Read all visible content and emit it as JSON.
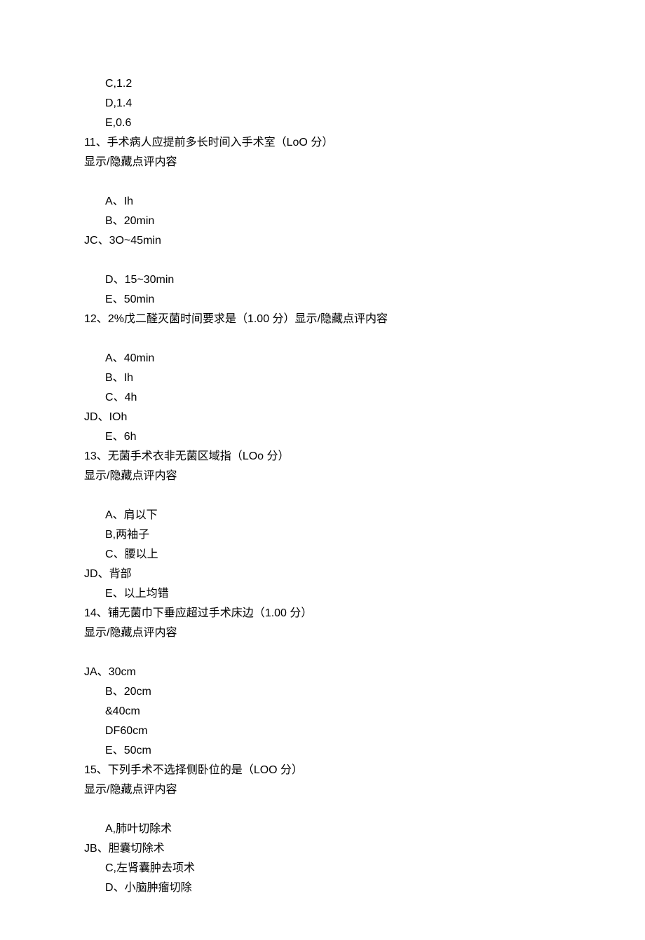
{
  "lines": [
    {
      "cls": "indent",
      "text": "C,1.2"
    },
    {
      "cls": "indent",
      "text": "D,1.4"
    },
    {
      "cls": "indent",
      "text": "E,0.6"
    },
    {
      "cls": "",
      "text": "11、手术病人应提前多长时间入手术室（LoO 分）"
    },
    {
      "cls": "",
      "text": "显示/隐藏点评内容"
    },
    {
      "cls": "",
      "text": ""
    },
    {
      "cls": "indent",
      "text": "A、Ih"
    },
    {
      "cls": "indent",
      "text": "B、20min"
    },
    {
      "cls": "",
      "text": "JC、3O~45min"
    },
    {
      "cls": "",
      "text": ""
    },
    {
      "cls": "indent",
      "text": "D、15~30min"
    },
    {
      "cls": "indent",
      "text": "E、50min"
    },
    {
      "cls": "",
      "text": "12、2%戊二醛灭菌时间要求是（1.00 分）显示/隐藏点评内容"
    },
    {
      "cls": "",
      "text": ""
    },
    {
      "cls": "indent",
      "text": "A、40min"
    },
    {
      "cls": "indent",
      "text": "B、Ih"
    },
    {
      "cls": "indent",
      "text": "C、4h"
    },
    {
      "cls": "",
      "text": "JD、IOh"
    },
    {
      "cls": "indent",
      "text": "E、6h"
    },
    {
      "cls": "",
      "text": "13、无菌手术衣非无菌区域指（LOo 分）"
    },
    {
      "cls": "",
      "text": "显示/隐藏点评内容"
    },
    {
      "cls": "",
      "text": ""
    },
    {
      "cls": "indent",
      "text": "A、肩以下"
    },
    {
      "cls": "indent",
      "text": "B,两袖子"
    },
    {
      "cls": "indent",
      "text": "C、腰以上"
    },
    {
      "cls": "",
      "text": "JD、背部"
    },
    {
      "cls": "indent",
      "text": "E、以上均错"
    },
    {
      "cls": "",
      "text": "14、铺无菌巾下垂应超过手术床边（1.00 分）"
    },
    {
      "cls": "",
      "text": "显示/隐藏点评内容"
    },
    {
      "cls": "",
      "text": ""
    },
    {
      "cls": "",
      "text": "JA、30cm"
    },
    {
      "cls": "indent",
      "text": "B、20cm"
    },
    {
      "cls": "indent",
      "text": "&40cm"
    },
    {
      "cls": "indent",
      "text": "DF60cm"
    },
    {
      "cls": "indent",
      "text": "E、50cm"
    },
    {
      "cls": "",
      "text": "15、下列手术不选择侧卧位的是（LOO 分）"
    },
    {
      "cls": "",
      "text": "显示/隐藏点评内容"
    },
    {
      "cls": "",
      "text": ""
    },
    {
      "cls": "indent",
      "text": "A,肺叶切除术"
    },
    {
      "cls": "",
      "text": "JB、胆囊切除术"
    },
    {
      "cls": "indent",
      "text": "C,左肾囊肿去项术"
    },
    {
      "cls": "indent",
      "text": "D、小脑肿瘤切除"
    }
  ]
}
